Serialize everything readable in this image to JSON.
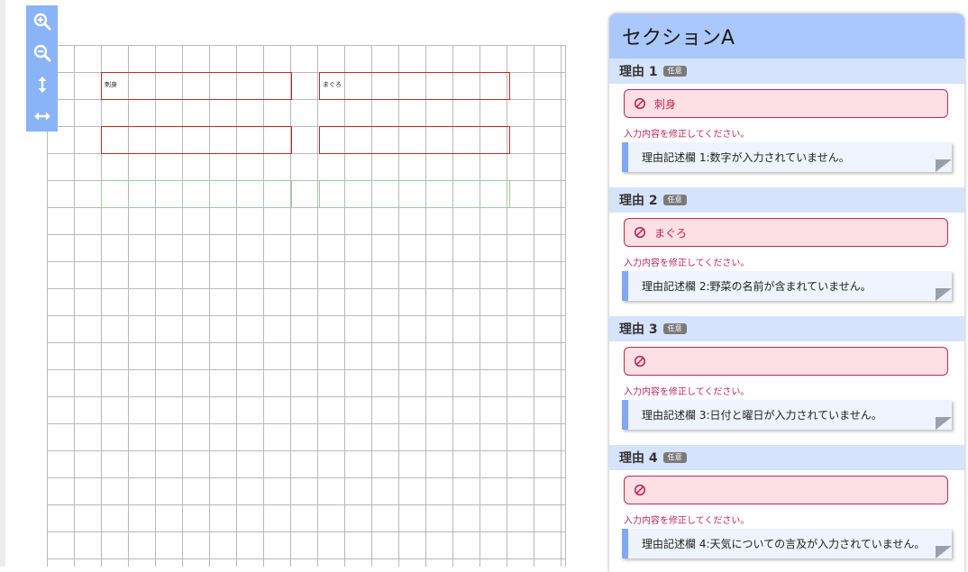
{
  "toolbar": {
    "buttons": [
      {
        "icon": "zoom-in-icon"
      },
      {
        "icon": "zoom-out-icon"
      },
      {
        "icon": "fit-height-icon"
      },
      {
        "icon": "fit-width-icon"
      }
    ]
  },
  "canvas": {
    "fields": [
      {
        "text": "刺身",
        "state": "error"
      },
      {
        "text": "まぐろ",
        "state": "error"
      },
      {
        "text": "",
        "state": "error"
      },
      {
        "text": "",
        "state": "error"
      },
      {
        "text": "",
        "state": "ok"
      },
      {
        "text": "",
        "state": "ok"
      }
    ]
  },
  "panel": {
    "title": "セクションA",
    "reasons": [
      {
        "title": "理由 1",
        "badge": "任意",
        "value": "刺身",
        "error": "入力内容を修正してください。",
        "note": "理由記述欄 1:数字が入力されていません。"
      },
      {
        "title": "理由 2",
        "badge": "任意",
        "value": "まぐろ",
        "error": "入力内容を修正してください。",
        "note": "理由記述欄 2:野菜の名前が含まれていません。"
      },
      {
        "title": "理由 3",
        "badge": "任意",
        "value": "",
        "error": "入力内容を修正してください。",
        "note": "理由記述欄 3:日付と曜日が入力されていません。"
      },
      {
        "title": "理由 4",
        "badge": "任意",
        "value": "",
        "error": "入力内容を修正してください。",
        "note": "理由記述欄 4:天気についての言及が入力されていません。"
      }
    ]
  },
  "colors": {
    "accent": "#8ab4f8",
    "header": "#aac8fc",
    "error": "#c0265a"
  }
}
